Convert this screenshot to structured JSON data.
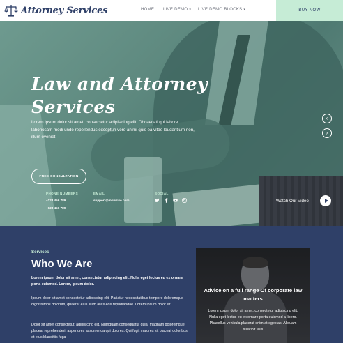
{
  "navbar": {
    "brand": "Attorney Services",
    "links": [
      {
        "label": "HOME",
        "has_caret": false
      },
      {
        "label": "LIVE DEMO",
        "has_caret": true
      },
      {
        "label": "LIVE DEMO BLOCKS",
        "has_caret": true
      }
    ],
    "caret": "▾",
    "cta": "BUY NOW",
    "logo_icon": "scales-of-justice-icon"
  },
  "hero": {
    "title_line1": "Law and Attorney",
    "title_line2": "Services",
    "description": "Lorem ipsum dolor sit amet, consectetur adipisicing elit. Obcaecati qui labore laboriosam modi unde repellendus excepturi vero animi quis ea vitae laudantium non, illum eveniet",
    "button": "FREE CONSULTATION",
    "prev_icon": "‹",
    "next_icon": "›",
    "contacts": {
      "phone_label": "PHONE NUMBERS",
      "phone_1": "+123 456 789",
      "phone_2": "+123 456 789",
      "email_label": "EMAIL",
      "email": "support@mobirise.com",
      "social_label": "SOCIAL",
      "social_icons": [
        "twitter-icon",
        "facebook-icon",
        "youtube-icon",
        "instagram-icon"
      ]
    },
    "video": {
      "label": "Watch Our Video"
    }
  },
  "services": {
    "eyebrow": "Services",
    "title_bold": "Who We",
    "title_light": "Are",
    "paragraphs": [
      "Lorem ipsum dolor sit amet, consectetur adipiscing elit. Nulla eget lectus eu ex ornare porta euismod. Lorem, ipsum dolor.",
      "Ipsum dolor sit amet consectetur adipisicing elit. Pariatur necessitatibus tempore doloremque dignissimos dolorum, quaerat eius illum alias eos repudiandae. Lorem ipsum dolor sit.",
      "Dolor sit amet consectetur, adipisicing elit. Numquam consequatur quia, magnam doloremque placeat reprehenderit asperiores assumenda qui dolores. Qui fugit maiores sit placeat doloribus, et eius blanditiis fuga"
    ],
    "card": {
      "title": "Advice on a full range Of corporate law matters",
      "text": "Lorem ipsum dolor sit amet, consectetur adipiscing elit. Nulla eget lectus eu ex ornare porta euismod a libero. Phasellus vehicula placerat enim at egestas. Aliquam suscipit felis"
    }
  },
  "colors": {
    "navy": "#2f4068",
    "mint": "#c6ecd6",
    "hero_tint": "#6e9a8f"
  }
}
